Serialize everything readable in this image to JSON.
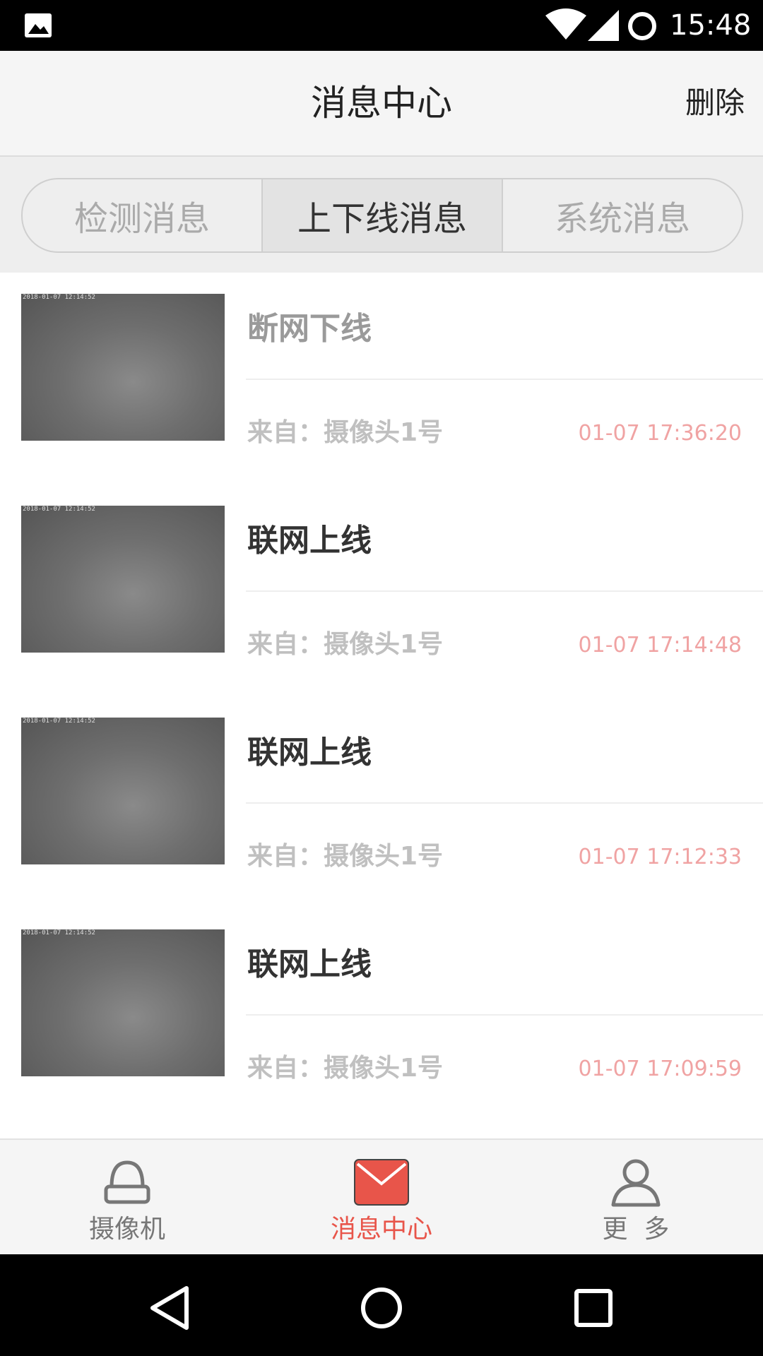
{
  "status_bar": {
    "time": "15:48",
    "icons": [
      "gallery-icon",
      "wifi-icon",
      "cell-signal-icon",
      "sync-icon"
    ]
  },
  "header": {
    "title": "消息中心",
    "delete_label": "删除"
  },
  "tabs": [
    {
      "label": "检测消息",
      "active": false
    },
    {
      "label": "上下线消息",
      "active": true
    },
    {
      "label": "系统消息",
      "active": false
    }
  ],
  "messages": [
    {
      "title": "断网下线",
      "from": "来自：摄像头1号",
      "time": "01-07 17:36:20",
      "stamp": "2018-01-07 12:14:52",
      "title_color": "#9a9a9a"
    },
    {
      "title": "联网上线",
      "from": "来自：摄像头1号",
      "time": "01-07 17:14:48",
      "stamp": "2018-01-07 12:14:52",
      "title_color": "#333333"
    },
    {
      "title": "联网上线",
      "from": "来自：摄像头1号",
      "time": "01-07 17:12:33",
      "stamp": "2018-01-07 12:14:52",
      "title_color": "#333333"
    },
    {
      "title": "联网上线",
      "from": "来自：摄像头1号",
      "time": "01-07 17:09:59",
      "stamp": "2018-01-07 12:14:52",
      "title_color": "#333333"
    }
  ],
  "bottom_nav": [
    {
      "label": "摄像机",
      "icon": "camera-icon",
      "active": false
    },
    {
      "label": "消息中心",
      "icon": "mail-icon",
      "active": true
    },
    {
      "label": "更  多",
      "icon": "person-icon",
      "active": false
    }
  ],
  "colors": {
    "accent": "#e8554a",
    "time_text": "#f0a3a3",
    "inactive_nav": "#777777"
  },
  "system_nav": [
    "back-icon",
    "home-icon",
    "recents-icon"
  ]
}
